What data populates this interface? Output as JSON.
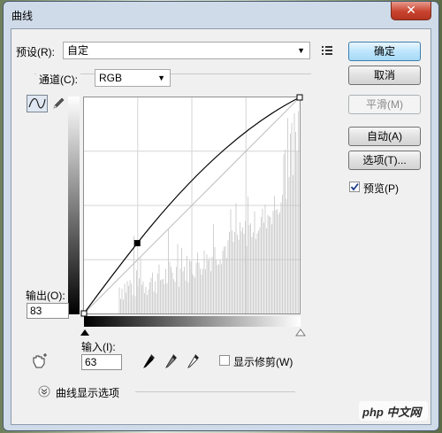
{
  "window": {
    "title": "曲线",
    "close_label": "✕"
  },
  "preset": {
    "label": "预设(R):",
    "value": "自定"
  },
  "channel": {
    "label": "通道(C):",
    "value": "RGB"
  },
  "buttons": {
    "ok": "确定",
    "cancel": "取消",
    "smooth": "平滑(M)",
    "auto": "自动(A)",
    "options": "选项(T)..."
  },
  "preview": {
    "label": "预览(P)",
    "checked": true
  },
  "output": {
    "label": "输出(O):",
    "value": "83"
  },
  "input": {
    "label": "输入(I):",
    "value": "63"
  },
  "show_clipping": {
    "label": "显示修剪(W)",
    "checked": false
  },
  "curve_display_options": {
    "label": "曲线显示选项"
  },
  "watermark": "php 中文网",
  "icons": [
    "preset-menu-icon",
    "curve-point-tool-icon",
    "pencil-tool-icon",
    "hand-target-icon",
    "black-eyedropper-icon",
    "gray-eyedropper-icon",
    "white-eyedropper-icon",
    "expand-chevron-icon"
  ],
  "colors": {
    "primary_button": "#bee6fd",
    "close_button": "#c8432f",
    "curve": "#000000"
  }
}
